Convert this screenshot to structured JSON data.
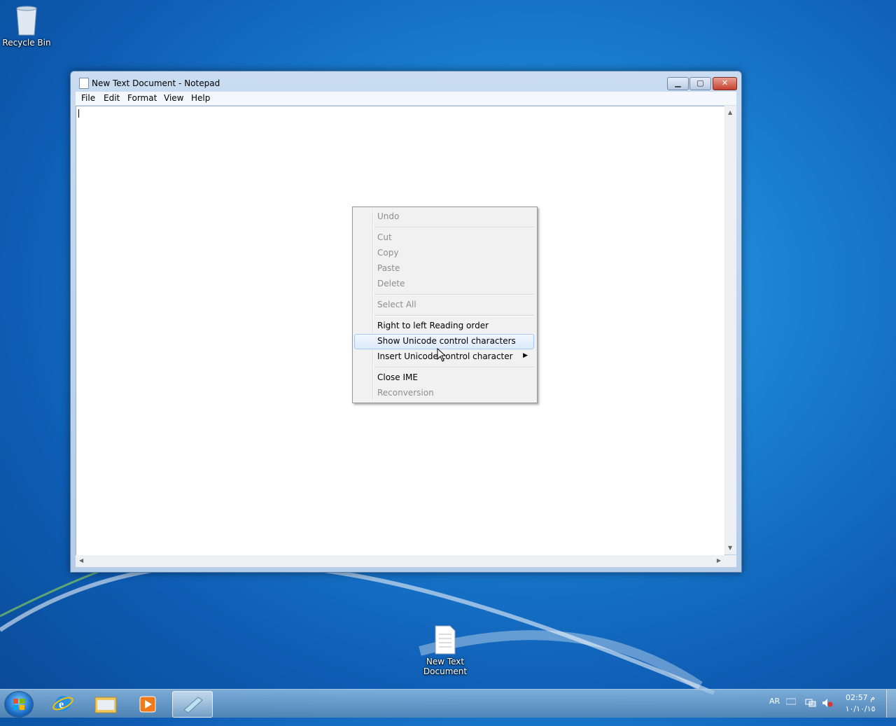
{
  "desktop": {
    "recycle_bin_label": "Recycle Bin",
    "new_text_doc_label_line1": "New Text",
    "new_text_doc_label_line2": "Document"
  },
  "window": {
    "title": "New Text Document - Notepad",
    "menu": [
      "File",
      "Edit",
      "Format",
      "View",
      "Help"
    ],
    "editor_content": ""
  },
  "context_menu": {
    "items": [
      {
        "label": "Undo",
        "enabled": false
      },
      {
        "label": "Cut",
        "enabled": false
      },
      {
        "label": "Copy",
        "enabled": false
      },
      {
        "label": "Paste",
        "enabled": false
      },
      {
        "label": "Delete",
        "enabled": false
      },
      {
        "label": "Select All",
        "enabled": false
      },
      {
        "label": "Right to left Reading order",
        "enabled": true
      },
      {
        "label": "Show Unicode control characters",
        "enabled": true,
        "highlighted": true
      },
      {
        "label": "Insert Unicode control character",
        "enabled": true,
        "submenu": true
      },
      {
        "label": "Close IME",
        "enabled": true
      },
      {
        "label": "Reconversion",
        "enabled": false
      }
    ]
  },
  "taskbar": {
    "pinned": [
      "windows-explorer",
      "internet-explorer",
      "libraries",
      "media-player",
      "notepad"
    ],
    "language": "AR",
    "time": "02:57 م",
    "date": "١٠/١٠/١٥"
  },
  "colors": {
    "menu_highlight": "#dce9fb",
    "disabled_text": "#8d8d8d"
  }
}
